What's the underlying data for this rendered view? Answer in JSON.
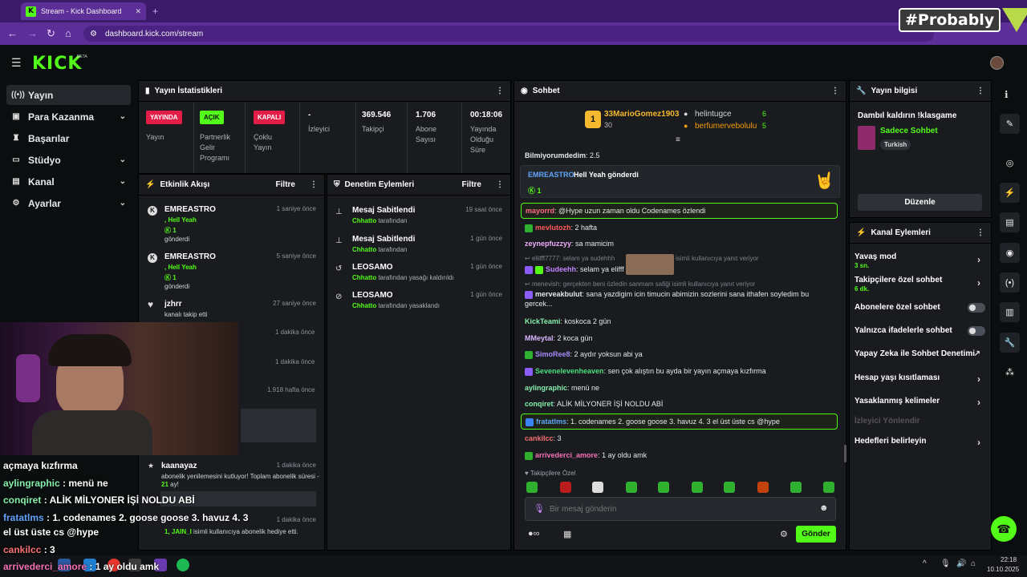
{
  "browser": {
    "tab_title": "Stream - Kick Dashboard",
    "url": "dashboard.kick.com/stream",
    "watermark": "#Probably"
  },
  "app": {
    "logo": "KICK",
    "beta": "BETA"
  },
  "nav": [
    {
      "label": "Yayın",
      "icon": "broadcast-icon"
    },
    {
      "label": "Para Kazanma",
      "icon": "wallet-icon"
    },
    {
      "label": "Başarılar",
      "icon": "trophy-icon"
    },
    {
      "label": "Stüdyo",
      "icon": "studio-icon"
    },
    {
      "label": "Kanal",
      "icon": "channel-icon"
    },
    {
      "label": "Ayarlar",
      "icon": "gear-icon"
    }
  ],
  "stats": {
    "title": "Yayın İstatistikleri",
    "cols": [
      {
        "badge": "YAYINDA",
        "label": "Yayın"
      },
      {
        "badge": "AÇIK",
        "label": "Partnerlik Gelir Programı"
      },
      {
        "badge": "KAPALI",
        "label": "Çoklu Yayın"
      },
      {
        "value": "-",
        "label": "İzleyici"
      },
      {
        "value": "369.546",
        "label": "Takipçi"
      },
      {
        "value": "1.706",
        "label": "Abone Sayısı"
      },
      {
        "value": "00:18:06",
        "label": "Yayında Olduğu Süre"
      }
    ]
  },
  "activity": {
    "title": "Etkinlik Akışı",
    "filter": "Filtre",
    "rows": [
      {
        "name": "EMREASTRO",
        "time": "1 saniye önce",
        "l1": ", Hell Yeah",
        "l2": "1",
        "l3": "gönderdi"
      },
      {
        "name": "EMREASTRO",
        "time": "5 saniye önce",
        "l1": ", Hell Yeah",
        "l2": "1",
        "l3": "gönderdi"
      },
      {
        "name": "jzhrr",
        "time": "27 saniye önce",
        "l1": "kanalı takip etti"
      }
    ],
    "times_hidden": [
      "1 dakika önce",
      "1 dakika önce",
      "1.918 hafta önce"
    ],
    "row_kaanayaz": {
      "name": "kaanayaz",
      "time": "1 dakika önce",
      "l1": "abonelik yenilemesini kutluyor! Toplam abonelik süresi -",
      "months": "21",
      "l1b": "ay!"
    },
    "row_last": {
      "time": "1 dakika önce",
      "l1": "1, JAIN_I",
      "l1b": "isimli kullanıcıya abonelik hediye etti."
    }
  },
  "moderation": {
    "title": "Denetim Eylemleri",
    "filter": "Filtre",
    "rows": [
      {
        "name": "Mesaj Sabitlendi",
        "by": "Chhatto",
        "rest": "tarafından",
        "time": "19 saat önce"
      },
      {
        "name": "Mesaj Sabitlendi",
        "by": "Chhatto",
        "rest": "tarafından",
        "time": "1 gün önce"
      },
      {
        "name": "LEOSAMO",
        "by": "Chhatto",
        "rest": "tarafından yasağı kaldırıldı",
        "time": "1 gün önce"
      },
      {
        "name": "LEOSAMO",
        "by": "Chhatto",
        "rest": "tarafından yasaklandı",
        "time": "1 gün önce"
      }
    ]
  },
  "chat": {
    "title": "Sohbet",
    "leader1": {
      "name": "33MarioGomez1903",
      "count": "30"
    },
    "leader2": {
      "name": "helintugce",
      "count": "6"
    },
    "leader3": {
      "name": "berfumervebolulu",
      "count": "5"
    },
    "gift": {
      "user": "EMREASTRO",
      "text": "Hell Yeah gönderdi",
      "count": "1"
    },
    "followers_only": "Takipçilere Özel",
    "input_placeholder": "Bir mesaj gönderin",
    "send": "Gönder",
    "messages": [
      {
        "user": "Bilmiyorumdedim",
        "text": "2.5",
        "color": "#d1d5db"
      },
      {
        "user": "mayorrd",
        "text": "@Hype uzun zaman oldu Codenames özlendi",
        "color": "#ff6a8a"
      },
      {
        "user": "mevlutozh",
        "text": "2 hafta",
        "color": "#ff5a5a"
      },
      {
        "user": "zeynepfuzzyy",
        "text": "sa mamicim",
        "color": "#f0abfc"
      },
      {
        "reply": "eliifff7777: selam ya sudehhh",
        "reply2": "isimli kullanıcıya yanıt veriyor",
        "user": "Sudeehh",
        "text": "selam ya elifff",
        "color": "#c084fc"
      },
      {
        "reply": "menevish: gerçekten beni özledin sanmam safiği isimli kullanıcıya yanıt veriyor",
        "user": "merveakbulut",
        "text": "sana yazdigim icin timucin abimizin sozlerini sana ithafen soyledim bu gercek...",
        "color": "#e5e7eb"
      },
      {
        "user": "KickTeami",
        "text": "koskoca 2 gün",
        "color": "#86efac"
      },
      {
        "user": "MMeytal",
        "text": "2 koca gün",
        "color": "#d8b4fe"
      },
      {
        "user": "SimoRee8",
        "text": "2 aydır yoksun abi ya",
        "color": "#a78bfa"
      },
      {
        "user": "Sevenelevenheaven",
        "text": "sen çok alıştın bu ayda bir yayın açmaya kızfırma",
        "color": "#4ade80"
      },
      {
        "user": "aylingraphic",
        "text": "menü ne",
        "color": "#86efac"
      },
      {
        "user": "conqiret",
        "text": "ALİK MİLYONER İŞİ NOLDU ABİ",
        "color": "#86efac"
      },
      {
        "user": "fratatlms",
        "text": "1. codenames 2. goose goose 3. havuz 4. 3 el üst üste cs @hype",
        "color": "#60a5fa"
      },
      {
        "user": "cankilcc",
        "text": "3",
        "color": "#f87171"
      },
      {
        "user": "arrivederci_amore",
        "text": "1 ay oldu amk",
        "color": "#f472b6"
      }
    ]
  },
  "stream_info": {
    "title": "Yayın bilgisi",
    "stream_title": "Dambıl kaldırın !klasgame",
    "category": "Sadece Sohbet",
    "tag": "Turkish",
    "edit": "Düzenle"
  },
  "channel_actions": {
    "title": "Kanal Eylemleri",
    "items": [
      {
        "label": "Yavaş mod",
        "sub": "3 sn."
      },
      {
        "label": "Takipçilere özel sohbet",
        "sub": "6 dk."
      },
      {
        "label": "Abonelere özel sohbet"
      },
      {
        "label": "Yalnızca ifadelerle sohbet"
      },
      {
        "label": "Yapay Zeka ile Sohbet Denetimi"
      },
      {
        "label": "Hesap yaşı kısıtlaması"
      },
      {
        "label": "Yasaklanmış kelimeler"
      },
      {
        "label": "İzleyici Yönlendir"
      },
      {
        "label": "Hedefleri belirleyin"
      }
    ]
  },
  "overlay": {
    "lines": [
      {
        "user": "",
        "text": "açmaya kızfırma"
      },
      {
        "user": "aylingraphic",
        "text": ": menü ne"
      },
      {
        "user": "conqiret",
        "text": ": ALİK MİLYONER İŞİ NOLDU ABİ"
      },
      {
        "user": "fratatlms",
        "text": ": 1. codenames 2. goose goose 3. havuz 4. 3"
      },
      {
        "user": "",
        "text": "el üst üste cs @hype"
      },
      {
        "user": "cankilcc",
        "text": ": 3"
      },
      {
        "user": "arrivederci_amore",
        "text": ": 1 ay oldu amk"
      }
    ]
  },
  "taskbar": {
    "time": "22:18",
    "date": "10.10.2025"
  },
  "colors": {
    "kick_green": "#53fc18",
    "live_red": "#e11d48",
    "panel": "#191b1f",
    "browser_purple": "#5b2e98"
  }
}
